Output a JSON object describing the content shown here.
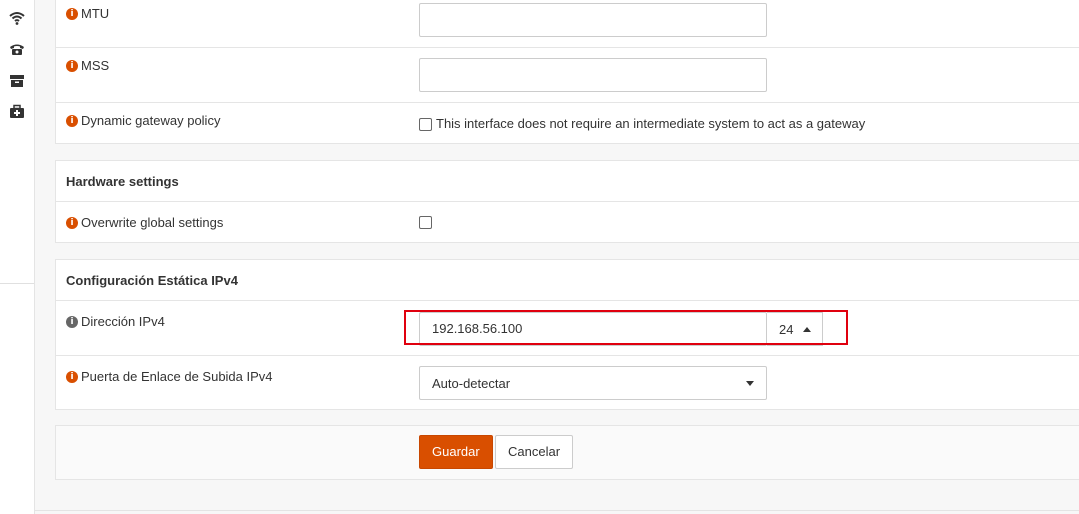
{
  "sidebar": {
    "icons": [
      "wifi-icon",
      "phone-icon",
      "archive-icon",
      "medkit-icon"
    ]
  },
  "interface_options": {
    "mtu": {
      "label": "MTU",
      "value": ""
    },
    "mss": {
      "label": "MSS",
      "value": ""
    },
    "dynamic_gateway": {
      "label": "Dynamic gateway policy",
      "checkbox_label": "This interface does not require an intermediate system to act as a gateway",
      "checked": false
    }
  },
  "hardware": {
    "title": "Hardware settings",
    "overwrite": {
      "label": "Overwrite global settings",
      "checked": false
    }
  },
  "ipv4_static": {
    "title": "Configuración Estática IPv4",
    "address": {
      "label": "Dirección IPv4",
      "value": "192.168.56.100",
      "subnet": "24"
    },
    "gateway": {
      "label": "Puerta de Enlace de Subida IPv4",
      "selected": "Auto-detectar"
    }
  },
  "actions": {
    "save_label": "Guardar",
    "cancel_label": "Cancelar"
  },
  "colors": {
    "accent": "#d94f00",
    "highlight": "#e0000e"
  }
}
